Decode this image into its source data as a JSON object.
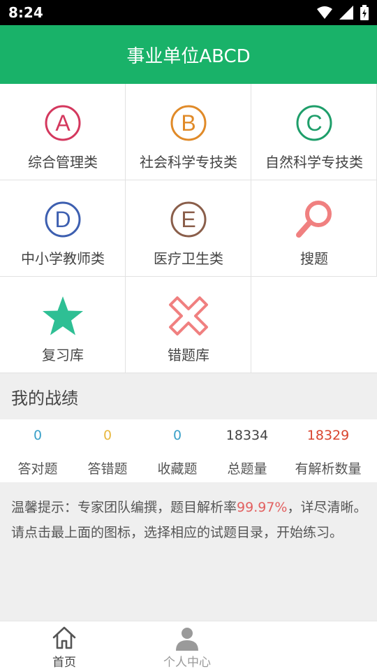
{
  "status_bar": {
    "time": "8:24"
  },
  "app": {
    "title": "事业单位ABCD"
  },
  "categories": [
    {
      "label": "综合管理类",
      "letter": "A",
      "color": "#d4385e"
    },
    {
      "label": "社会科学专技类",
      "letter": "B",
      "color": "#e08a28"
    },
    {
      "label": "自然科学专技类",
      "letter": "C",
      "color": "#1e9e6a"
    },
    {
      "label": "中小学教师类",
      "letter": "D",
      "color": "#3d5fb0"
    },
    {
      "label": "医疗卫生类",
      "letter": "E",
      "color": "#8a5e4a"
    },
    {
      "label": "搜题",
      "icon": "search-icon",
      "color": "#f08080"
    },
    {
      "label": "复习库",
      "icon": "star-icon",
      "color": "#2ebf94"
    },
    {
      "label": "错题库",
      "icon": "cross-icon",
      "color": "#f08080"
    }
  ],
  "section": {
    "title": "我的战绩"
  },
  "stats": [
    {
      "value": "0",
      "label": "答对题",
      "color": "#3aa0c8"
    },
    {
      "value": "0",
      "label": "答错题",
      "color": "#e8b840"
    },
    {
      "value": "0",
      "label": "收藏题",
      "color": "#3aa0c8"
    },
    {
      "value": "18334",
      "label": "总题量",
      "color": "#444444"
    },
    {
      "value": "18329",
      "label": "有解析数量",
      "color": "#d9452e"
    }
  ],
  "tips": {
    "line1_prefix": "温馨提示：专家团队编撰，题目解析率",
    "line1_highlight": "99.97%",
    "line1_suffix": "，详尽清晰。",
    "line2": "请点击最上面的图标，选择相应的试题目录，开始练习。"
  },
  "bottom_nav": [
    {
      "label": "首页",
      "icon": "home-icon",
      "active": true
    },
    {
      "label": "个人中心",
      "icon": "person-icon",
      "active": false
    }
  ]
}
